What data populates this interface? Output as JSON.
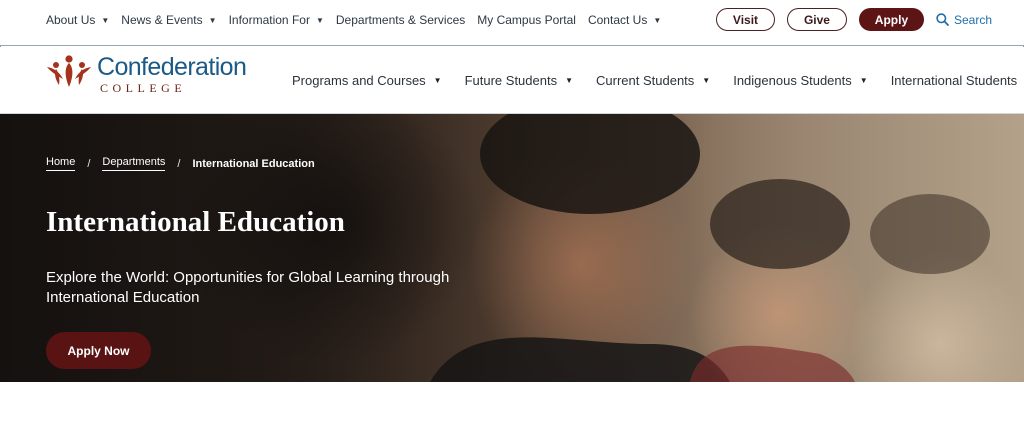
{
  "utility_nav": {
    "items": [
      {
        "label": "About Us",
        "has_dropdown": true
      },
      {
        "label": "News & Events",
        "has_dropdown": true
      },
      {
        "label": "Information For",
        "has_dropdown": true
      },
      {
        "label": "Departments & Services",
        "has_dropdown": false
      },
      {
        "label": "My Campus Portal",
        "has_dropdown": false
      },
      {
        "label": "Contact Us",
        "has_dropdown": true
      }
    ],
    "visit_label": "Visit",
    "give_label": "Give",
    "apply_label": "Apply",
    "search_label": "Search",
    "search_icon": "search-icon"
  },
  "logo": {
    "name": "Confederation",
    "sub": "COLLEGE"
  },
  "main_nav": {
    "items": [
      {
        "label": "Programs and Courses"
      },
      {
        "label": "Future Students"
      },
      {
        "label": "Current Students"
      },
      {
        "label": "Indigenous Students"
      },
      {
        "label": "International Students"
      }
    ]
  },
  "hero": {
    "breadcrumb": {
      "home": "Home",
      "departments": "Departments",
      "current": "International Education",
      "separator": "/"
    },
    "title": "International Education",
    "subtitle": "Explore the World: Opportunities for Global Learning through International Education",
    "cta_label": "Apply Now"
  },
  "colors": {
    "brand_blue": "#1b5a86",
    "brand_maroon": "#5c1414",
    "link_blue": "#1e6fa8"
  }
}
